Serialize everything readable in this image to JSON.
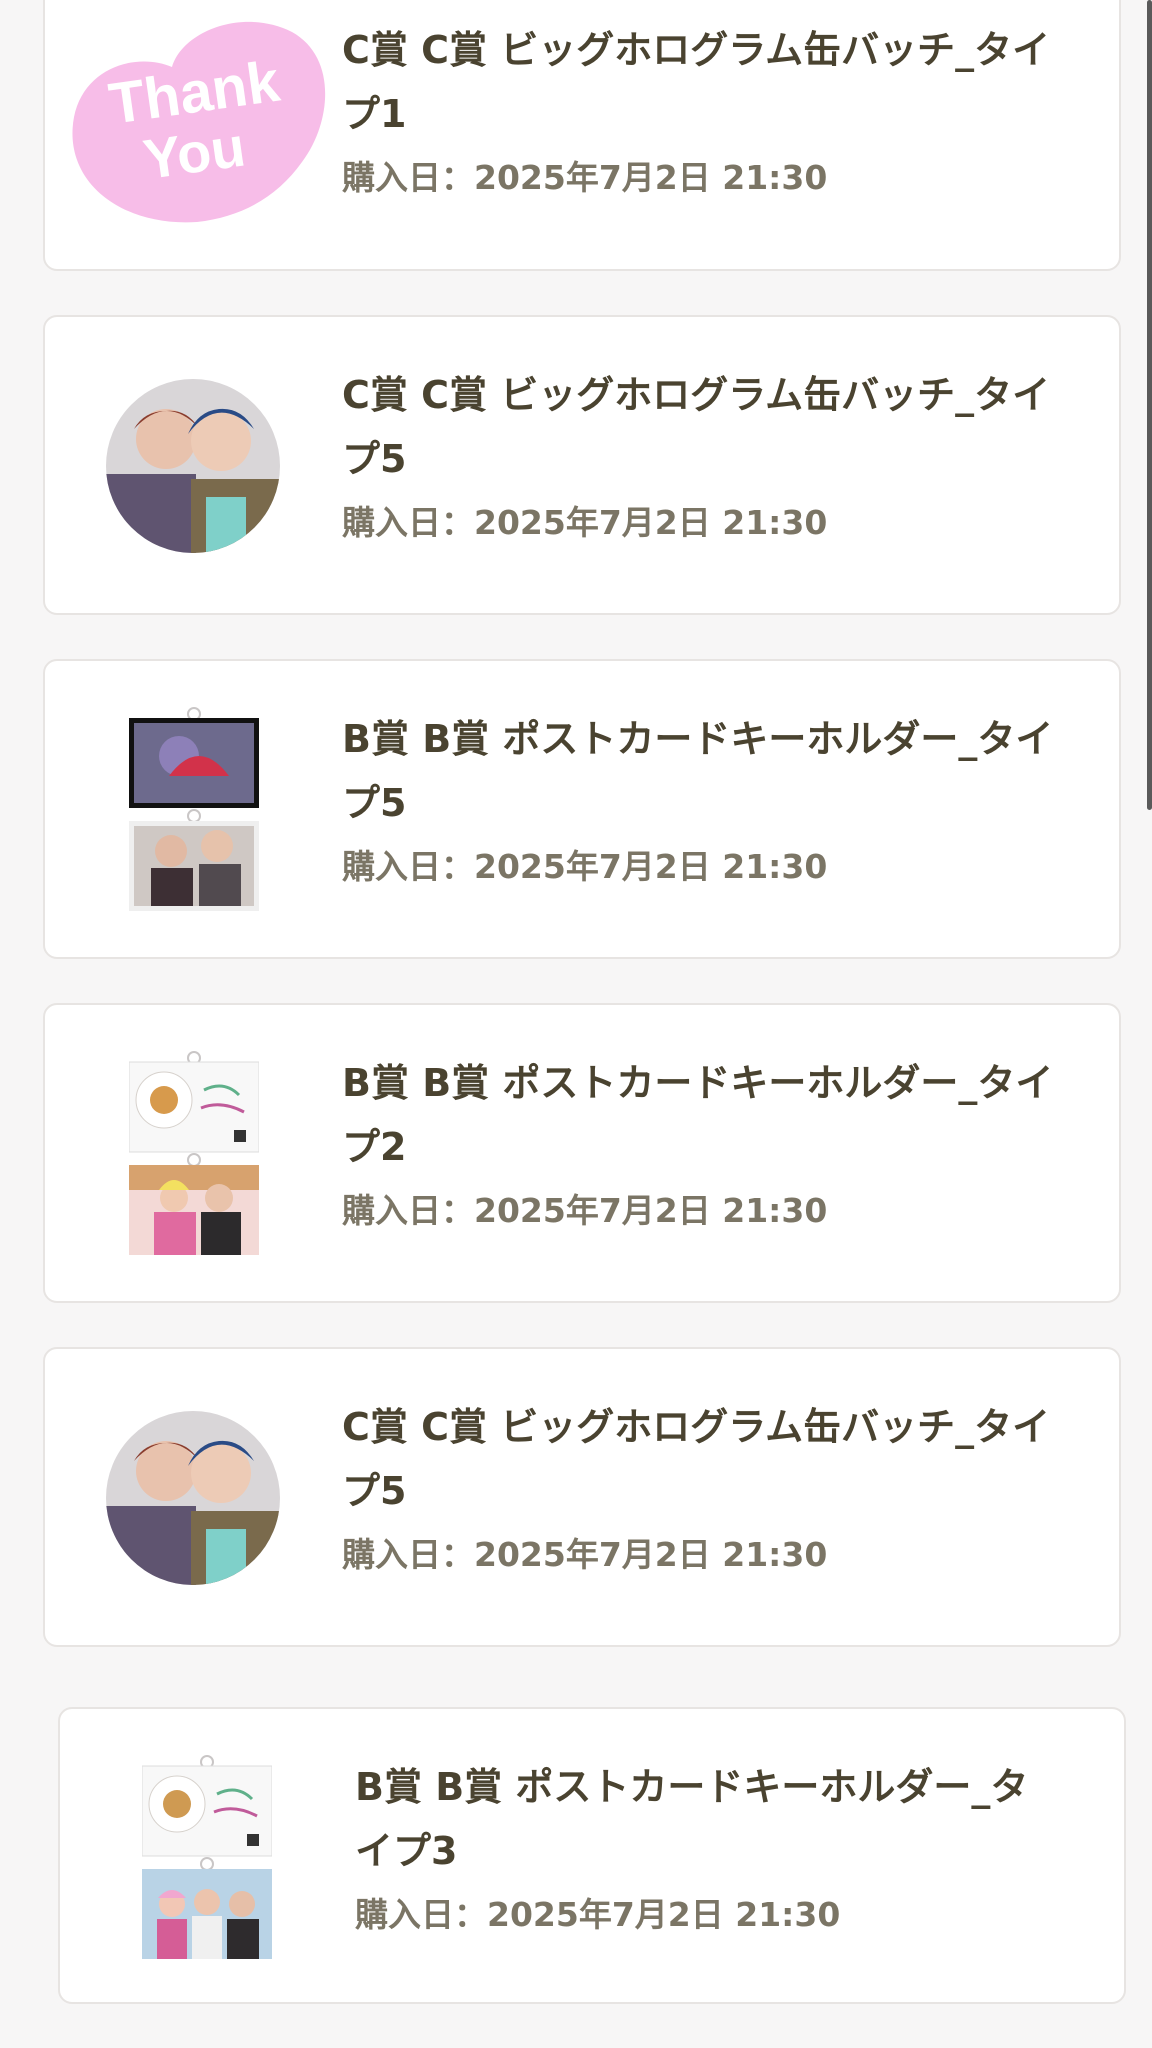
{
  "purchases": [
    {
      "title": "C賞 C賞 ビッグホログラム缶バッチ_タイプ1",
      "date": "購入日：2025年7月2日 21:30",
      "thumb_text": [
        "Thank",
        "You"
      ],
      "thumb_color": "#f7bde8"
    },
    {
      "title": "C賞 C賞 ビッグホログラム缶バッチ_タイプ5",
      "date": "購入日：2025年7月2日 21:30"
    },
    {
      "title": "B賞 B賞 ポストカードキーホルダー_タイプ5",
      "date": "購入日：2025年7月2日 21:30"
    },
    {
      "title": "B賞 B賞 ポストカードキーホルダー_タイプ2",
      "date": "購入日：2025年7月2日 21:30"
    },
    {
      "title": "C賞 C賞 ビッグホログラム缶バッチ_タイプ5",
      "date": "購入日：2025年7月2日 21:30"
    },
    {
      "title": "B賞 B賞 ポストカードキーホルダー_タイプ3",
      "date": "購入日：2025年7月2日 21:30"
    }
  ],
  "colors": {
    "text": "#4a4330",
    "date_text": "#7b7565",
    "card_border": "#e7e4e2",
    "background": "#f7f6f6"
  }
}
